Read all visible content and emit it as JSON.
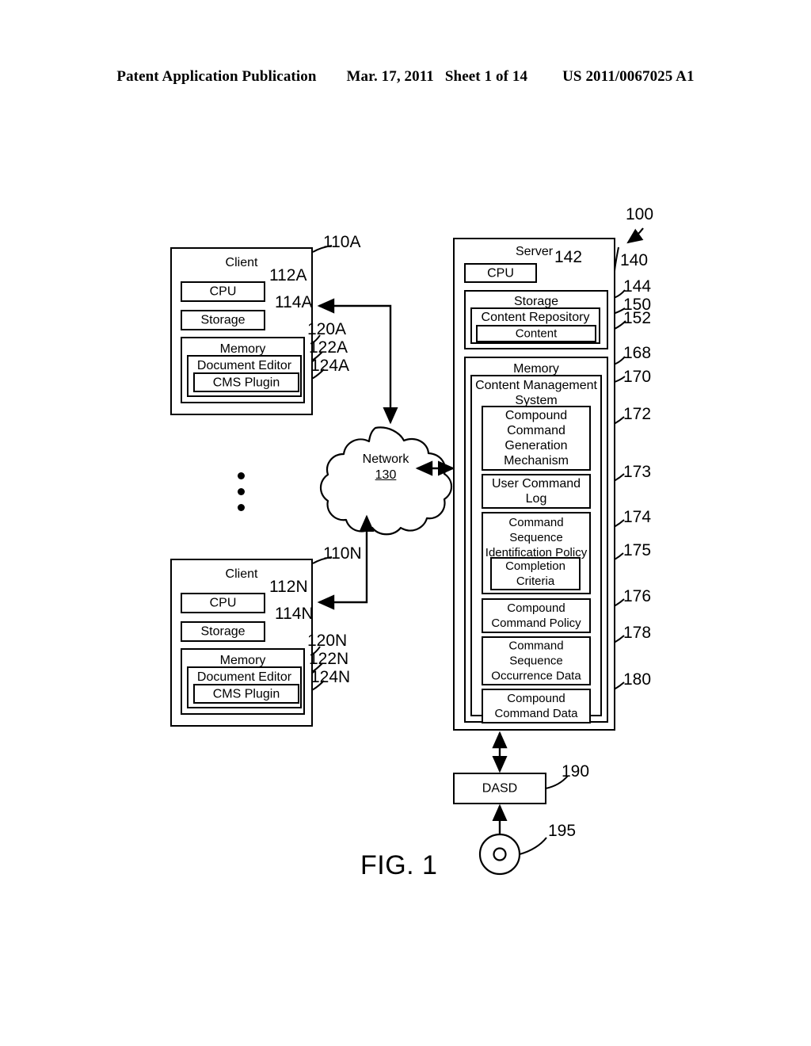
{
  "header": {
    "publication": "Patent Application Publication",
    "date": "Mar. 17, 2011",
    "sheet": "Sheet 1 of 14",
    "patent_number": "US 2011/0067025 A1"
  },
  "figure": {
    "caption": "FIG. 1",
    "system_ref": "100"
  },
  "clients": [
    {
      "title": "Client",
      "ref": "110A",
      "cpu": {
        "label": "CPU",
        "ref": "112A"
      },
      "storage": {
        "label": "Storage",
        "ref": "114A"
      },
      "memory": {
        "label": "Memory",
        "ref": "120A"
      },
      "document_editor": {
        "label": "Document Editor",
        "ref": "122A"
      },
      "cms_plugin": {
        "label": "CMS Plugin",
        "ref": "124A"
      }
    },
    {
      "title": "Client",
      "ref": "110N",
      "cpu": {
        "label": "CPU",
        "ref": "112N"
      },
      "storage": {
        "label": "Storage",
        "ref": "114N"
      },
      "memory": {
        "label": "Memory",
        "ref": "120N"
      },
      "document_editor": {
        "label": "Document Editor",
        "ref": "122N"
      },
      "cms_plugin": {
        "label": "CMS Plugin",
        "ref": "124N"
      }
    }
  ],
  "network": {
    "label": "Network",
    "ref": "130"
  },
  "server": {
    "title": "Server",
    "ref": "140",
    "cpu": {
      "label": "CPU",
      "ref": "142"
    },
    "storage": {
      "label": "Storage",
      "ref": "144"
    },
    "content_repository": {
      "label": "Content Repository",
      "ref": "150"
    },
    "content": {
      "label": "Content",
      "ref": "152"
    },
    "memory": {
      "label": "Memory",
      "ref": "168"
    },
    "cms": {
      "label_line1": "Content Management",
      "label_line2": "System",
      "ref": "170"
    },
    "modules": [
      {
        "lines": [
          "Compound",
          "Command",
          "Generation",
          "Mechanism"
        ],
        "ref": "172"
      },
      {
        "lines": [
          "User Command",
          "Log"
        ],
        "ref": "173"
      },
      {
        "lines": [
          "Command",
          "Sequence",
          "Identification Policy"
        ],
        "ref": "174"
      },
      {
        "lines": [
          "Completion",
          "Criteria"
        ],
        "ref": "175"
      },
      {
        "lines": [
          "Compound",
          "Command Policy"
        ],
        "ref": "176"
      },
      {
        "lines": [
          "Command",
          "Sequence",
          "Occurrence Data"
        ],
        "ref": "178"
      },
      {
        "lines": [
          "Compound",
          "Command Data"
        ],
        "ref": "180"
      }
    ]
  },
  "dasd": {
    "label": "DASD",
    "ref": "190"
  },
  "media": {
    "ref": "195"
  }
}
